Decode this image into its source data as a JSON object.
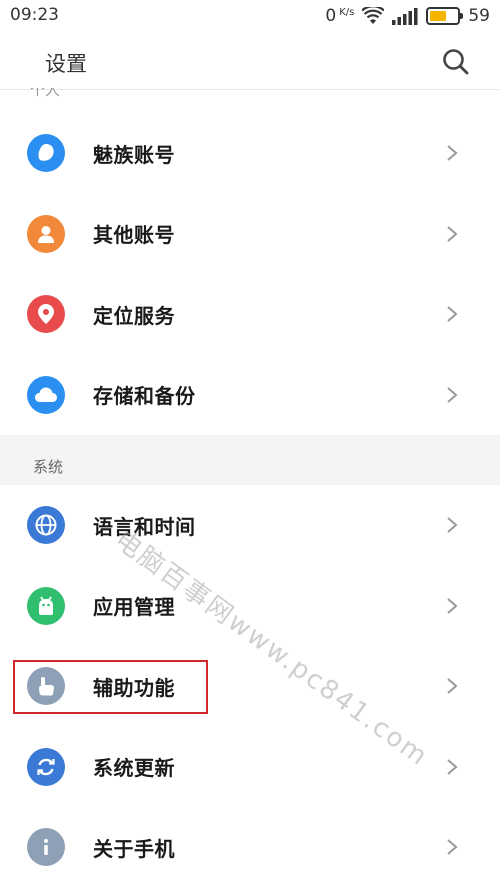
{
  "status_bar": {
    "time": "09:23",
    "net_speed": "0",
    "net_unit": "K/s",
    "battery_level": "59",
    "battery_fraction": 0.59
  },
  "app_bar": {
    "title": "设置",
    "search_icon": "search-icon"
  },
  "clipped_section": "个人",
  "sections": {
    "personal_items": [
      {
        "label": "魅族账号",
        "icon": "meizu-account-icon",
        "color": "#2a8ff0"
      },
      {
        "label": "其他账号",
        "icon": "person-icon",
        "color": "#f2893a"
      },
      {
        "label": "定位服务",
        "icon": "location-pin-icon",
        "color": "#e84b4b"
      },
      {
        "label": "存储和备份",
        "icon": "cloud-icon",
        "color": "#2a8ff0"
      }
    ],
    "system_header": "系统",
    "system_items": [
      {
        "label": "语言和时间",
        "icon": "globe-icon",
        "color": "#3a79d6"
      },
      {
        "label": "应用管理",
        "icon": "android-icon",
        "color": "#2fbf6e"
      },
      {
        "label": "辅助功能",
        "icon": "hand-pointer-icon",
        "color": "#8ea0b5"
      },
      {
        "label": "系统更新",
        "icon": "refresh-icon",
        "color": "#3a79d6"
      },
      {
        "label": "关于手机",
        "icon": "info-icon",
        "color": "#8ea0b5"
      }
    ]
  },
  "watermark": "电脑百事网www.pc841.com",
  "colors": {
    "highlight": "#d0282c",
    "section_bg": "#f4f4f4",
    "chevron": "#999999"
  }
}
